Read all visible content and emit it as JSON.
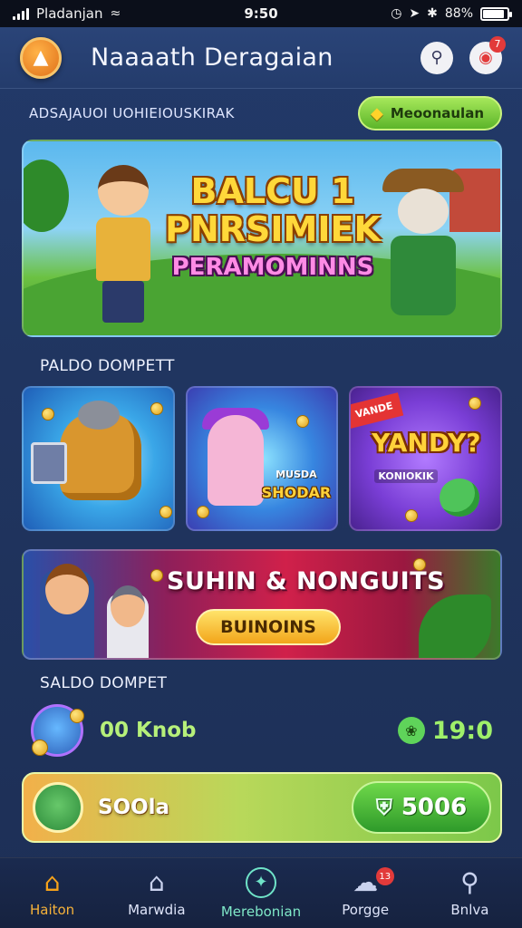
{
  "status_bar": {
    "carrier": "Pladanjan",
    "time": "9:50",
    "battery": "88%",
    "battery_level": 0.88,
    "icons": [
      "signal-icon",
      "wifi-icon",
      "alarm-icon",
      "location-icon",
      "bluetooth-icon",
      "battery-icon"
    ]
  },
  "header": {
    "title": "Naaaath Deragaian",
    "logo_icon": "fox-logo-icon",
    "search_icon": "search-icon",
    "notification_icon": "notification-icon",
    "notification_count": "7"
  },
  "promo": {
    "text": "ADSAJAUOI UOHIEIOUSKIRAK",
    "button_label": "Meoonaulan",
    "button_icon": "diamond-icon"
  },
  "hero_banner": {
    "line1": "BALCU 1",
    "line2": "PNRSIMIEK",
    "line3": "PERAMOMINNS"
  },
  "section1": {
    "label": "PALDO DOMPETT"
  },
  "tiles": [
    {
      "name": "creature-game"
    },
    {
      "name": "character-game",
      "title": "MUSDA",
      "subtitle": "SHODAR"
    },
    {
      "name": "yandy-game",
      "ribbon": "VANDE",
      "title": "YANDY?",
      "subtitle": "KONIOKIK"
    }
  ],
  "bonus_banner": {
    "title": "SUHIN & NONGUITS",
    "button_label": "BUINOINS"
  },
  "section2": {
    "label": "SALDO DOMPET"
  },
  "wallet": {
    "value": "00 Knob",
    "right_value": "19:0",
    "right_icon": "leaf-icon"
  },
  "balance": {
    "label": "SOOla",
    "button_value": "5006",
    "button_icon": "shield-icon"
  },
  "bottom_nav": [
    {
      "label": "Haiton",
      "icon": "home-icon",
      "active": true
    },
    {
      "label": "Marwdia",
      "icon": "shop-icon"
    },
    {
      "label": "Merebonian",
      "icon": "compass-icon"
    },
    {
      "label": "Porgge",
      "icon": "gift-icon",
      "badge": "13"
    },
    {
      "label": "Bnlva",
      "icon": "search-icon"
    }
  ],
  "colors": {
    "background": "#203560",
    "accent_green": "#5cb52a",
    "accent_orange": "#f6a21a",
    "badge_red": "#e23a3a"
  }
}
